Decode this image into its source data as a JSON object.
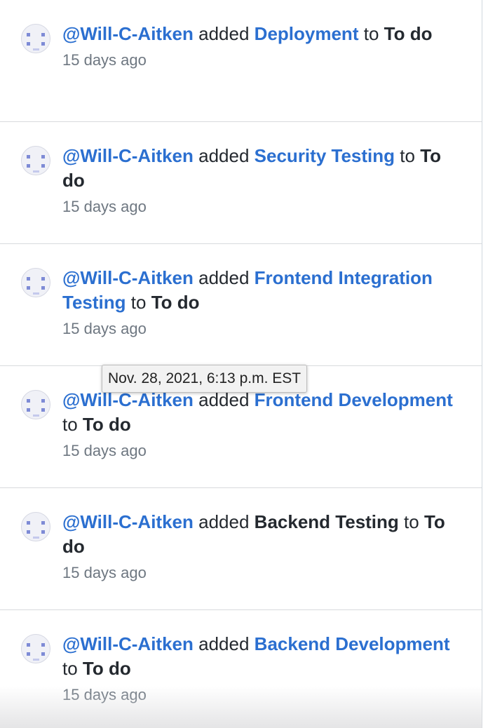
{
  "feed": {
    "items": [
      {
        "user": "@Will-C-Aitken",
        "verb": "added",
        "card": "Deployment",
        "card_is_link": true,
        "prep": "to",
        "column": "To do",
        "time": "15 days ago"
      },
      {
        "user": "@Will-C-Aitken",
        "verb": "added",
        "card": "Security Testing",
        "card_is_link": true,
        "prep": "to",
        "column": "To do",
        "time": "15 days ago"
      },
      {
        "user": "@Will-C-Aitken",
        "verb": "added",
        "card": "Frontend Integration Testing",
        "card_is_link": true,
        "prep": "to",
        "column": "To do",
        "time": "15 days ago"
      },
      {
        "user": "@Will-C-Aitken",
        "verb": "added",
        "card": "Frontend Development",
        "card_is_link": true,
        "prep": "to",
        "column": "To do",
        "time": "15 days ago"
      },
      {
        "user": "@Will-C-Aitken",
        "verb": "added",
        "card": "Backend Testing",
        "card_is_link": false,
        "prep": "to",
        "column": "To do",
        "time": "15 days ago"
      },
      {
        "user": "@Will-C-Aitken",
        "verb": "added",
        "card": "Backend Development",
        "card_is_link": true,
        "prep": "to",
        "column": "To do",
        "time": "15 days ago"
      }
    ]
  },
  "tooltip": {
    "text": "Nov. 28, 2021, 6:13 p.m. EST"
  },
  "colors": {
    "link": "#2b6fd0",
    "text": "#24292f",
    "muted": "#6e7781",
    "avatar_pixel": "#7e8bd6"
  }
}
